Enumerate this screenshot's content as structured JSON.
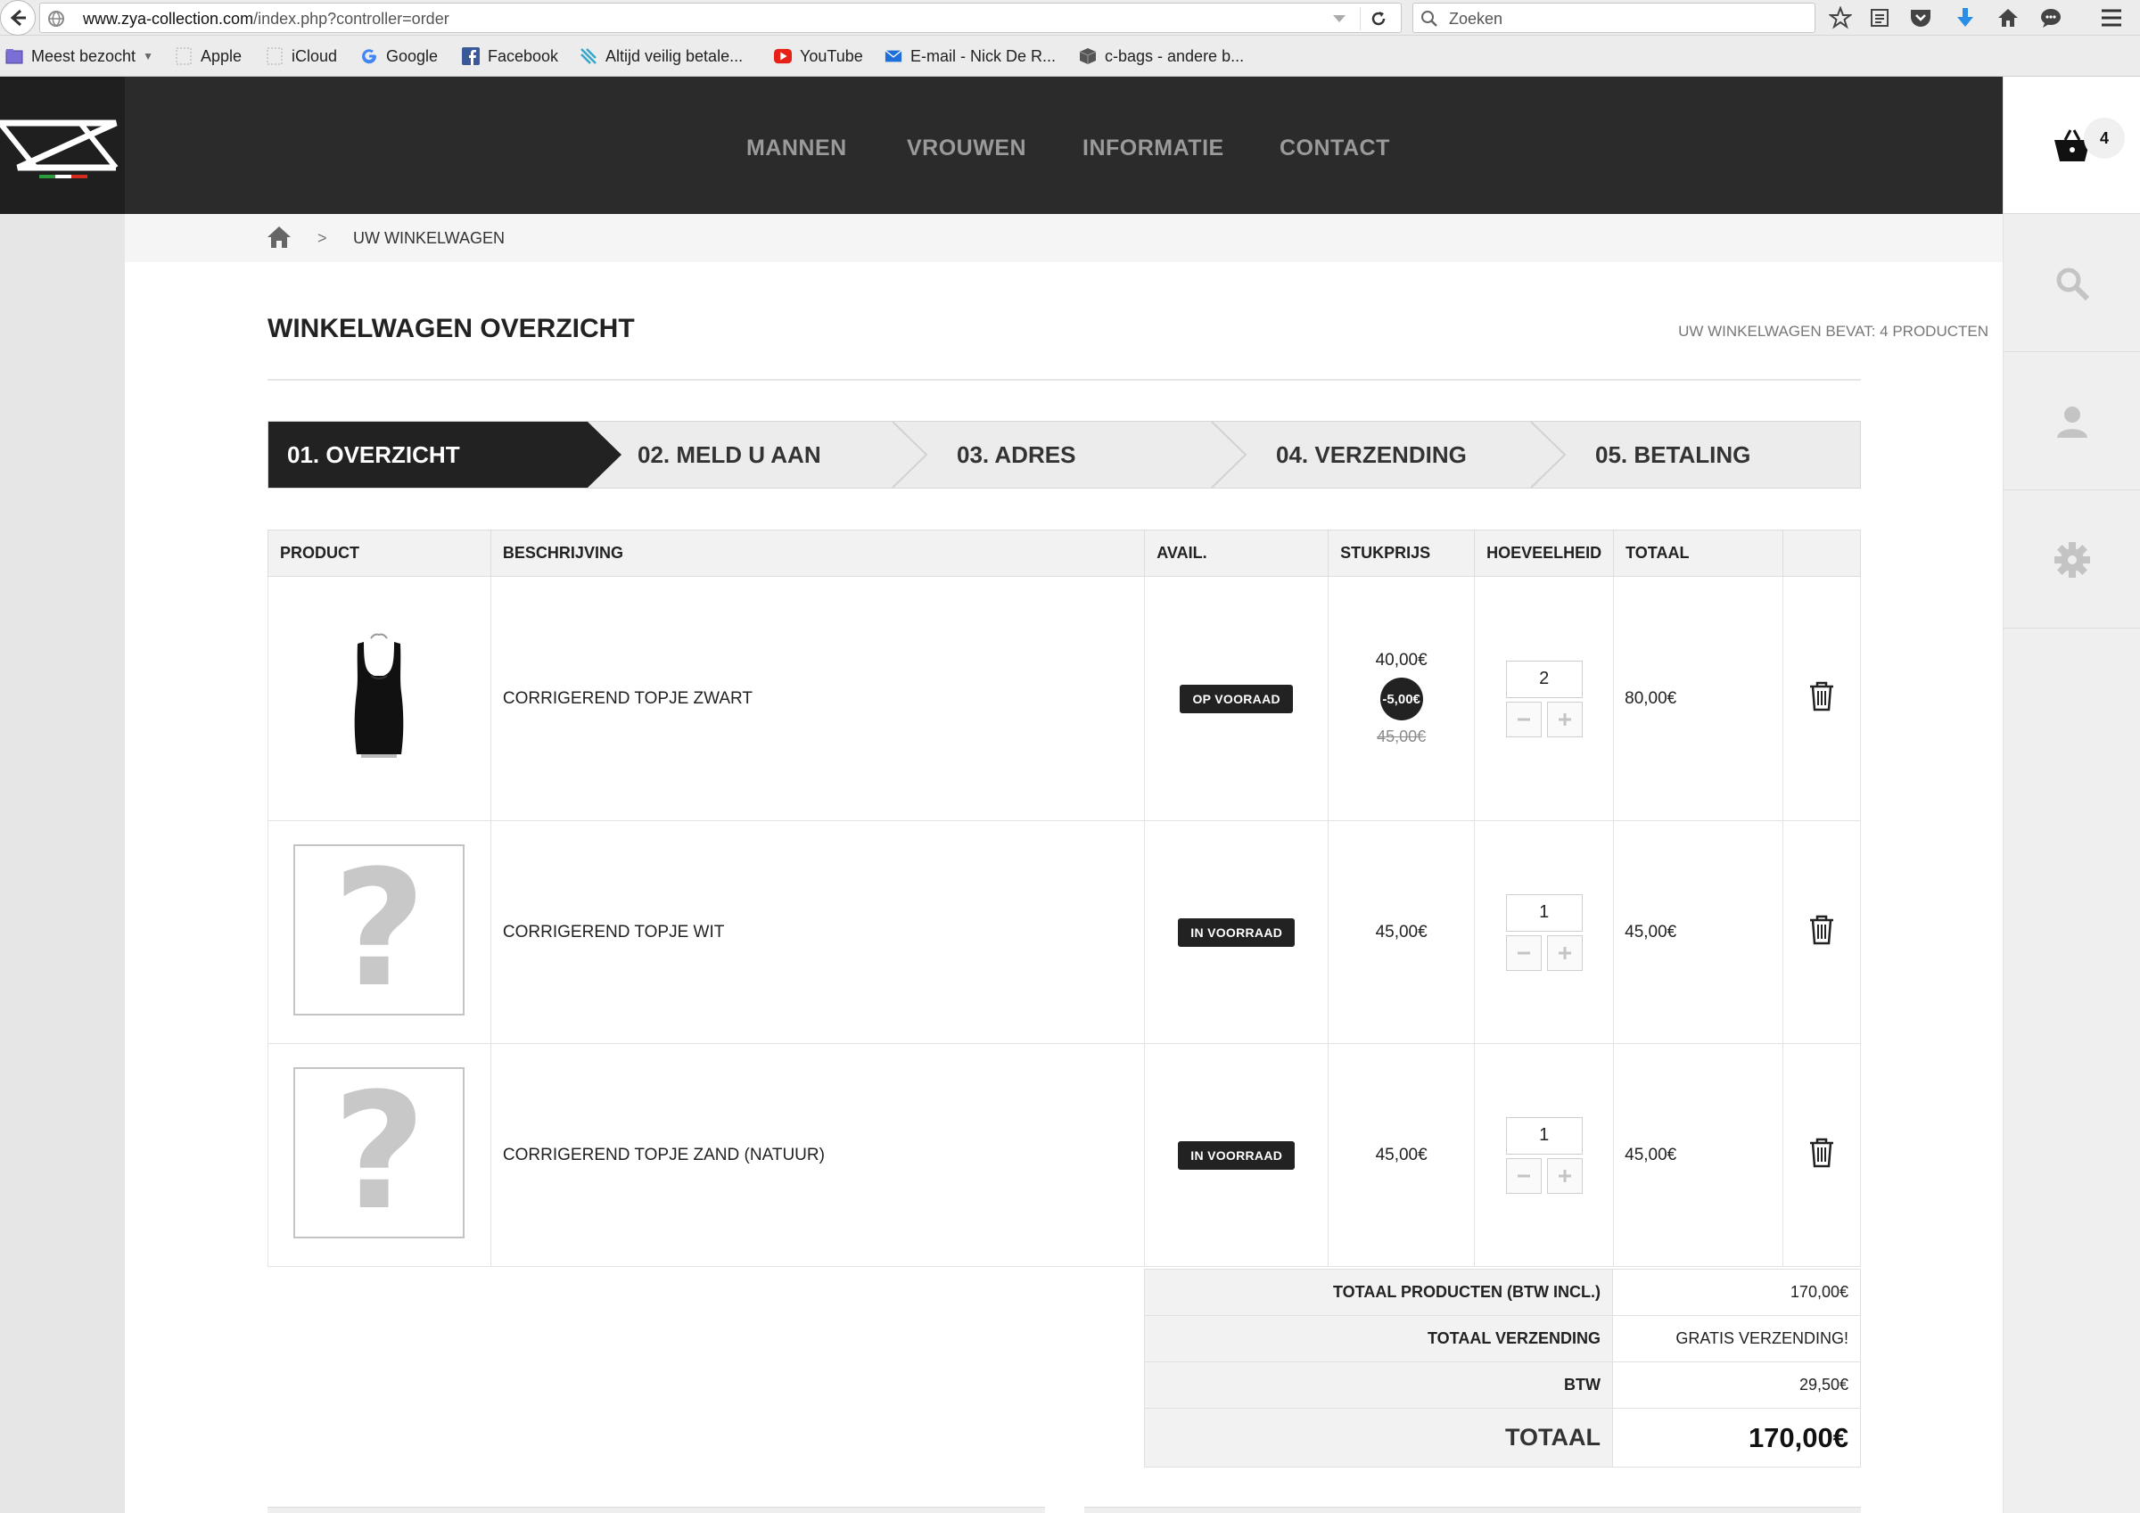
{
  "browser": {
    "url_domain": "www.zya-collection.com",
    "url_path": "/index.php?controller=order",
    "search_placeholder": "Zoeken",
    "bookmarks": [
      {
        "label": "Meest bezocht"
      },
      {
        "label": "Apple"
      },
      {
        "label": "iCloud"
      },
      {
        "label": "Google"
      },
      {
        "label": "Facebook"
      },
      {
        "label": "Altijd veilig betale..."
      },
      {
        "label": "YouTube"
      },
      {
        "label": "E-mail - Nick De R..."
      },
      {
        "label": "c-bags - andere b..."
      }
    ]
  },
  "site": {
    "nav": [
      "MANNEN",
      "VROUWEN",
      "INFORMATIE",
      "CONTACT"
    ],
    "cart_count": "4",
    "breadcrumb_sep": ">",
    "breadcrumb_current": "UW WINKELWAGEN",
    "page_title": "WINKELWAGEN OVERZICHT",
    "cart_summary": "UW WINKELWAGEN BEVAT: 4 PRODUCTEN",
    "steps": [
      "01. OVERZICHT",
      "02. MELD U AAN",
      "03. ADRES",
      "04. VERZENDING",
      "05. BETALING"
    ],
    "active_step": 0,
    "table_headers": {
      "product": "PRODUCT",
      "description": "BESCHRIJVING",
      "avail": "AVAIL.",
      "unit_price": "STUKPRIJS",
      "quantity": "HOEVEELHEID",
      "total": "TOTAAL"
    },
    "items": [
      {
        "name": "CORRIGEREND TOPJE ZWART",
        "stock": "OP VOORAAD",
        "price": "40,00€",
        "reduction": "-5,00€",
        "old_price": "45,00€",
        "qty": "2",
        "total": "80,00€"
      },
      {
        "name": "CORRIGEREND TOPJE WIT",
        "stock": "IN VOORRAAD",
        "price": "45,00€",
        "qty": "1",
        "total": "45,00€",
        "placeholder_mark": "?"
      },
      {
        "name": "CORRIGEREND TOPJE ZAND (NATUUR)",
        "stock": "IN VOORRAAD",
        "price": "45,00€",
        "qty": "1",
        "total": "45,00€",
        "placeholder_mark": "?"
      }
    ],
    "totals": {
      "products_label": "TOTAAL PRODUCTEN (BTW INCL.)",
      "products_value": "170,00€",
      "shipping_label": "TOTAAL VERZENDING",
      "shipping_value": "GRATIS VERZENDING!",
      "tax_label": "BTW",
      "tax_value": "29,50€",
      "grand_label": "TOTAAL",
      "grand_value": "170,00€"
    }
  },
  "colors": {
    "header_bg": "#2b2b2b",
    "active_step_bg": "#222222",
    "badge_bg": "#222222",
    "nav_text": "#9a9a9a"
  }
}
